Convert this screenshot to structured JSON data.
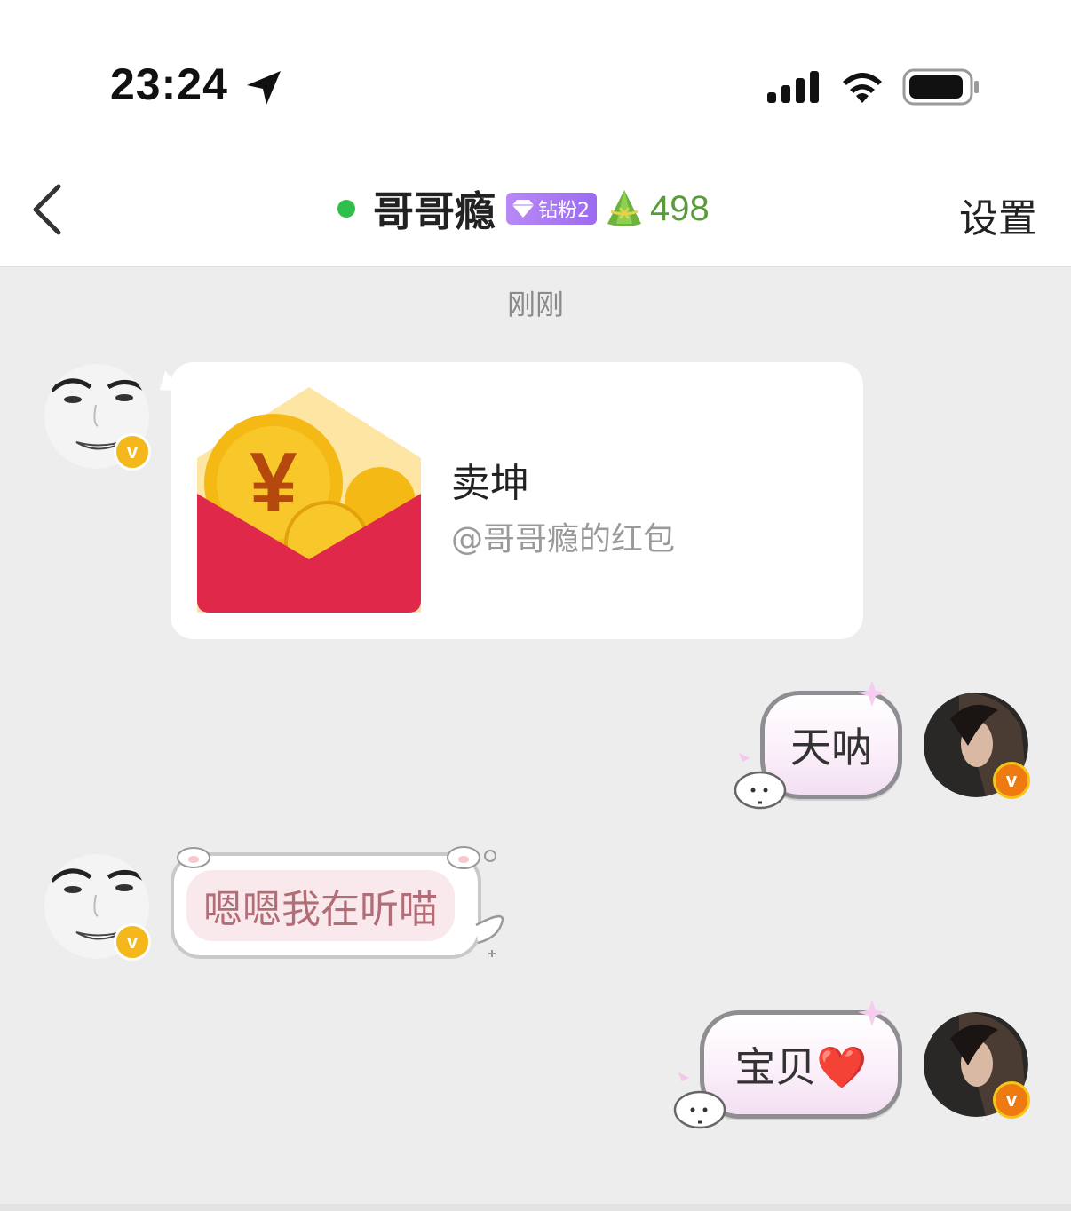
{
  "status_bar": {
    "time": "23:24"
  },
  "header": {
    "title": "哥哥瘾",
    "fan_badge": "钻粉2",
    "score": "498",
    "settings_label": "设置"
  },
  "chat": {
    "timestamp": "刚刚",
    "red_packet": {
      "title": "卖坤",
      "subtitle": "@哥哥瘾的红包"
    },
    "messages": [
      {
        "side": "right",
        "text": "天呐"
      },
      {
        "side": "left",
        "text": "嗯嗯我在听喵"
      },
      {
        "side": "right",
        "text": "宝贝❤️"
      }
    ]
  },
  "colors": {
    "online": "#2fbf4a",
    "badge_purple": "#a57af2",
    "score_green": "#5a9b3c",
    "verified_yellow": "#f5b81c",
    "verified_orange": "#f07a12",
    "red_packet": "#e0294a"
  }
}
